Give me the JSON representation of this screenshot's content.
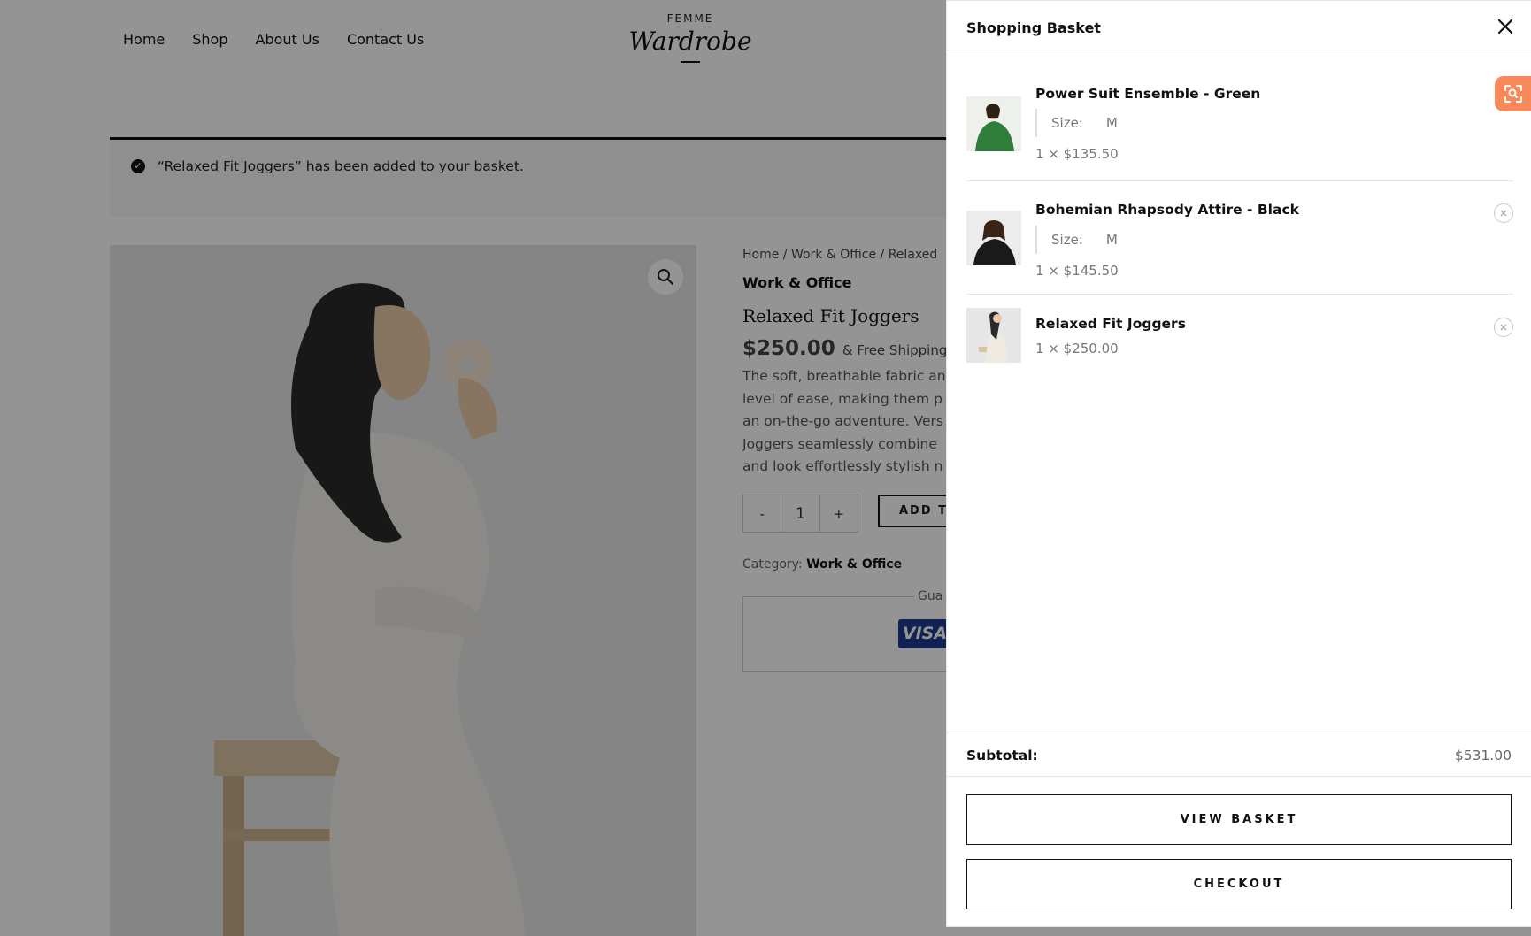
{
  "nav": {
    "items": [
      "Home",
      "Shop",
      "About Us",
      "Contact Us"
    ]
  },
  "brand": {
    "top": "FEMME",
    "name": "Wardrobe"
  },
  "notice": {
    "text": "“Relaxed Fit Joggers” has been added to your basket."
  },
  "product": {
    "breadcrumb": "Home / Work & Office / Relaxed",
    "category_title": "Work & Office",
    "title": "Relaxed Fit Joggers",
    "price": "$250.00",
    "shipping": "& Free Shipping",
    "description_lines": [
      "The soft, breathable fabric an",
      "level of ease, making them p",
      "an on-the-go adventure. Vers",
      "Joggers seamlessly combine",
      "and look effortlessly stylish n"
    ],
    "qty_minus": "-",
    "qty_value": "1",
    "qty_plus": "+",
    "add_button": "ADD TO",
    "category_label": "Category:",
    "category_value": "Work & Office",
    "guarantee_label": "Gua",
    "visa": "VISA",
    "image_icon": "zoom-icon"
  },
  "cart": {
    "title": "Shopping Basket",
    "close_icon": "close-icon",
    "items": [
      {
        "name": "Power Suit Ensemble - Green",
        "size_label": "Size:",
        "size_value": "M",
        "qty_price": "1 × $135.50",
        "thumb_color": "#2e7d3a"
      },
      {
        "name": "Bohemian Rhapsody Attire - Black",
        "size_label": "Size:",
        "size_value": "M",
        "qty_price": "1 × $145.50",
        "thumb_color": "#1a1a1a"
      },
      {
        "name": "Relaxed Fit Joggers",
        "qty_price": "1 × $250.00",
        "thumb_color": "#e0dcd4"
      }
    ],
    "subtotal_label": "Subtotal:",
    "subtotal_value": "$531.00",
    "view_button": "VIEW BASKET",
    "checkout_button": "CHECKOUT"
  },
  "colors": {
    "accent_capture": "#f6885a",
    "overlay": "rgba(0,0,0,0.42)",
    "visa_blue": "#1a3b8f"
  }
}
